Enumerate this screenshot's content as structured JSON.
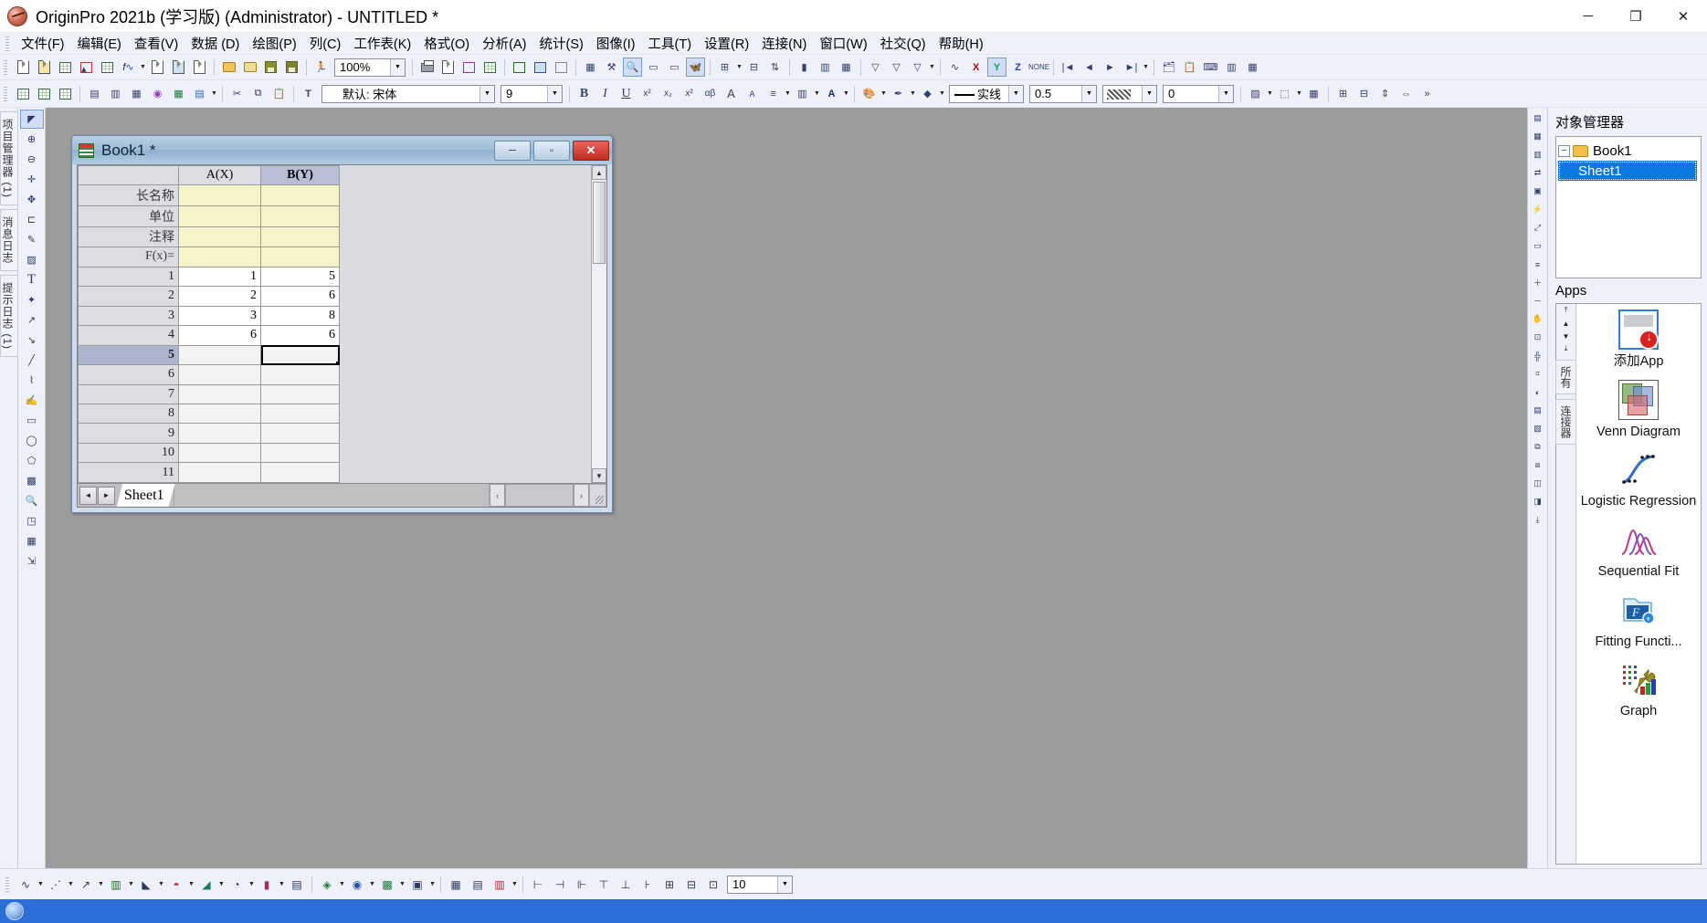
{
  "window": {
    "title": "OriginPro 2021b (学习版) (Administrator) - UNTITLED *",
    "app_icon": "origin-logo-icon",
    "minimize": "─",
    "maximize": "❐",
    "close": "✕"
  },
  "menubar": {
    "items": [
      {
        "label": "文件(F)"
      },
      {
        "label": "编辑(E)"
      },
      {
        "label": "查看(V)"
      },
      {
        "label": "数据 (D)"
      },
      {
        "label": "绘图(P)"
      },
      {
        "label": "列(C)"
      },
      {
        "label": "工作表(K)"
      },
      {
        "label": "格式(O)"
      },
      {
        "label": "分析(A)"
      },
      {
        "label": "统计(S)"
      },
      {
        "label": "图像(I)"
      },
      {
        "label": "工具(T)"
      },
      {
        "label": "设置(R)"
      },
      {
        "label": "连接(N)"
      },
      {
        "label": "窗口(W)"
      },
      {
        "label": "社交(Q)"
      },
      {
        "label": "帮助(H)"
      }
    ]
  },
  "toolbar_standard": {
    "zoom_value": "100%",
    "groups": [
      [
        "new-project-icon",
        "new-folder-icon",
        "new-workbook-icon",
        "new-graph-icon",
        "new-matrix-icon",
        "new-function-icon",
        "new-notes-icon",
        "new-layout-icon",
        "new-excel-icon"
      ],
      [
        "open-icon",
        "open-template-icon",
        "save-project-icon",
        "save-template-icon"
      ],
      [
        "run-script-icon"
      ]
    ],
    "print_group": [
      "print-icon",
      "print-preview-icon",
      "copy-page-icon"
    ],
    "edit_group": [
      "import-wizard-icon",
      "import-single-ascii-icon",
      "import-multiple-ascii-icon",
      "digitizer-icon",
      "clear-worksheet-icon",
      "copy-columns-icon",
      "unstack-icon",
      "refresh-icon",
      "lock-icon",
      "new-layer-icon"
    ],
    "analysis_group": [
      "stats-columns-icon",
      "stats-rows-icon",
      "sort-range-icon",
      "histogram-icon",
      "column-plot-icon",
      "scatter-plot-icon",
      "filter-icon",
      "unfilter-icon",
      "reset-filter-icon"
    ],
    "tools_group": [
      "fit-linear-icon",
      "x-function-icon",
      "y-function-icon",
      "z-function-icon",
      "nonlinear-fit-icon"
    ],
    "nav_group": [
      "first-icon",
      "prev-icon",
      "next-icon",
      "last-icon"
    ],
    "misc_group": [
      "project-explorer-icon",
      "results-log-icon",
      "code-builder-icon",
      "layer-contents-icon",
      "rescale-icon"
    ]
  },
  "toolbar_format": {
    "font_name": "默认: 宋体",
    "font_size": "9",
    "bold": "B",
    "italic": "I",
    "underline": "U",
    "superscript": "x²",
    "subscript": "x₂",
    "supersub": "x²",
    "greek": "αβ",
    "increase_font": "A",
    "decrease_font": "A",
    "line_style": "实线",
    "line_width": "0.5",
    "fill_pattern": "",
    "transparency": "0",
    "align_icon": "align-icon",
    "pattern_icon": "pattern-icon",
    "text-color_icon": "text-color-icon"
  },
  "left_tabs": [
    {
      "label": "项目管理器 (1)",
      "name": "project-explorer-tab"
    },
    {
      "label": "消息日志",
      "name": "message-log-tab"
    },
    {
      "label": "提示日志 (1)",
      "name": "hint-log-tab"
    }
  ],
  "left_tools": [
    {
      "name": "pointer-tool",
      "glyph": "◤",
      "selected": true
    },
    {
      "name": "magnify-in-tool",
      "glyph": "⊕"
    },
    {
      "name": "magnify-out-tool",
      "glyph": "⊖"
    },
    {
      "name": "data-reader-tool",
      "glyph": "✛"
    },
    {
      "name": "screen-reader-tool",
      "glyph": "✥"
    },
    {
      "name": "data-selector-tool",
      "glyph": "⊏"
    },
    {
      "name": "draw-data-tool",
      "glyph": "✎"
    },
    {
      "name": "regional-mask-tool",
      "glyph": "▨"
    },
    {
      "name": "text-tool",
      "glyph": "T"
    },
    {
      "name": "wizard-tool",
      "glyph": "✦"
    },
    {
      "name": "arrow-tool",
      "glyph": "↗"
    },
    {
      "name": "curved-arrow-tool",
      "glyph": "↘"
    },
    {
      "name": "line-tool",
      "glyph": "╱"
    },
    {
      "name": "polyline-tool",
      "glyph": "⌇"
    },
    {
      "name": "freehand-tool",
      "glyph": "✍"
    },
    {
      "name": "rectangle-tool",
      "glyph": "▭"
    },
    {
      "name": "circle-tool",
      "glyph": "◯"
    },
    {
      "name": "polygon-tool",
      "glyph": "⬠"
    },
    {
      "name": "region-tool",
      "glyph": "▩"
    },
    {
      "name": "zoom-region-tool",
      "glyph": "🔍"
    },
    {
      "name": "object-tool",
      "glyph": "◳"
    },
    {
      "name": "grid-tool",
      "glyph": "▦"
    },
    {
      "name": "scale-tool",
      "glyph": "⇲"
    }
  ],
  "right_tools": [
    {
      "name": "add-layer-icon",
      "glyph": "▤"
    },
    {
      "name": "merge-graph-icon",
      "glyph": "▦"
    },
    {
      "name": "extract-layers-icon",
      "glyph": "▥"
    },
    {
      "name": "exchange-layers-icon",
      "glyph": "⇄"
    },
    {
      "name": "layer-management-icon",
      "glyph": "▣"
    },
    {
      "name": "speed-mode-icon",
      "glyph": "⚡"
    },
    {
      "name": "rescale-layers-icon",
      "glyph": "⤢"
    },
    {
      "name": "new-legend-icon",
      "glyph": "▭"
    },
    {
      "name": "reorder-legend-icon",
      "glyph": "≡"
    },
    {
      "name": "scale-in-icon",
      "glyph": "＋"
    },
    {
      "name": "scale-out-icon",
      "glyph": "－"
    },
    {
      "name": "pan-icon",
      "glyph": "✋"
    },
    {
      "name": "fit-page-icon",
      "glyph": "⊡"
    },
    {
      "name": "axis-dialog-icon",
      "glyph": "╬"
    },
    {
      "name": "grid-lines-icon",
      "glyph": "⌗"
    },
    {
      "name": "plot-details-icon",
      "glyph": "◐"
    },
    {
      "name": "layer-contents-icon",
      "glyph": "▤"
    },
    {
      "name": "color-map-icon",
      "glyph": "▧"
    },
    {
      "name": "stack-icon",
      "glyph": "⧉"
    },
    {
      "name": "duplicate-icon",
      "glyph": "⧈"
    },
    {
      "name": "masking-icon",
      "glyph": "◫"
    },
    {
      "name": "theme-icon",
      "glyph": "◨"
    },
    {
      "name": "export-graph-icon",
      "glyph": "⤓"
    }
  ],
  "worksheet_window": {
    "title": "Book1 *",
    "icon": "workbook-icon",
    "minimize": "─",
    "maximize": "▫",
    "close": "✕",
    "columns": [
      {
        "label": "",
        "name": "row-header-column"
      },
      {
        "label": "A(X)",
        "name": "column-a",
        "selected": false
      },
      {
        "label": "B(Y)",
        "name": "column-b",
        "selected": true
      }
    ],
    "meta_rows": [
      {
        "label": "长名称",
        "name": "long-name-row",
        "a": "",
        "b": ""
      },
      {
        "label": "单位",
        "name": "units-row",
        "a": "",
        "b": ""
      },
      {
        "label": "注释",
        "name": "comments-row",
        "a": "",
        "b": ""
      },
      {
        "label": "F(x)=",
        "name": "formula-row",
        "a": "",
        "b": ""
      }
    ],
    "data_rows": [
      {
        "n": "1",
        "a": "1",
        "b": "5"
      },
      {
        "n": "2",
        "a": "2",
        "b": "6"
      },
      {
        "n": "3",
        "a": "3",
        "b": "8"
      },
      {
        "n": "4",
        "a": "6",
        "b": "6"
      },
      {
        "n": "5",
        "a": "",
        "b": "",
        "selected": true,
        "current_cell": "b"
      },
      {
        "n": "6",
        "a": "",
        "b": ""
      },
      {
        "n": "7",
        "a": "",
        "b": ""
      },
      {
        "n": "8",
        "a": "",
        "b": ""
      },
      {
        "n": "9",
        "a": "",
        "b": ""
      },
      {
        "n": "10",
        "a": "",
        "b": ""
      },
      {
        "n": "11",
        "a": "",
        "b": ""
      }
    ],
    "sheet_tab": "Sheet1",
    "nav_prev": "◄",
    "nav_next": "►",
    "scroll_up": "▲",
    "scroll_down": "▼",
    "scroll_left": "‹",
    "scroll_right": "›"
  },
  "object_manager": {
    "title": "对象管理器",
    "tree": [
      {
        "label": "Book1",
        "name": "tree-node-book1",
        "expander": "−",
        "icon": "folder-icon",
        "level": 0,
        "selected": false
      },
      {
        "label": "Sheet1",
        "name": "tree-node-sheet1",
        "level": 1,
        "selected": true
      }
    ]
  },
  "apps_panel": {
    "title": "Apps",
    "rail_buttons": [
      "⤒",
      "▲",
      "▼",
      "⤓"
    ],
    "rail_tabs": [
      "所有",
      "连接器"
    ],
    "items": [
      {
        "label": "添加App",
        "name": "app-add-app",
        "icon": "add-app-icon"
      },
      {
        "label": "Venn Diagram",
        "name": "app-venn-diagram",
        "icon": "venn-diagram-icon"
      },
      {
        "label": "Logistic Regression",
        "name": "app-logistic-regression",
        "icon": "logistic-regression-icon"
      },
      {
        "label": "Sequential Fit",
        "name": "app-sequential-fit",
        "icon": "sequential-fit-icon"
      },
      {
        "label": "Fitting Functi...",
        "name": "app-fitting-function",
        "icon": "fitting-function-icon"
      },
      {
        "label": "Graph",
        "name": "app-graph",
        "icon": "graph-icon"
      }
    ]
  },
  "bottom_toolbar": {
    "font_size_value": "10",
    "groups": [
      [
        "line-plot-icon",
        "scatter-icon",
        "line-symbol-icon",
        "column-bar-icon",
        "area-icon",
        "pie-icon",
        "multi-curve-icon",
        "stock-icon",
        "misc-icon"
      ],
      [
        "3d-scatter-icon",
        "3d-surface-icon",
        "3d-bar-icon",
        "contour-icon"
      ],
      [
        "image-plot-icon",
        "matrix-icon",
        "statistics-plot-icon"
      ],
      [
        "align-left-icon",
        "align-center-icon",
        "align-right-icon",
        "align-top-icon",
        "align-middle-icon",
        "align-bottom-icon",
        "distribute-h-icon",
        "distribute-v-icon",
        "group-icon"
      ]
    ]
  },
  "statusbar": {
    "icon": "status-origin-icon",
    "text": ""
  }
}
